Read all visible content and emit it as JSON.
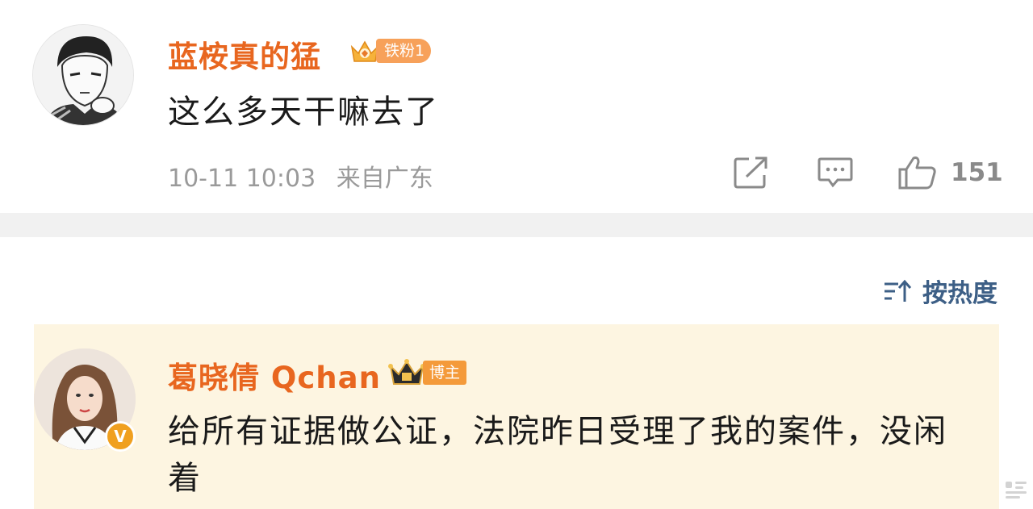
{
  "top_comment": {
    "username": "蓝桉真的猛",
    "fan_badge": "铁粉1",
    "text": "这么多天干嘛去了",
    "date": "10-11 10:03",
    "location": "来自广东",
    "like_count": "151",
    "icons": [
      "share-icon",
      "comment-icon",
      "like-icon"
    ]
  },
  "sort": {
    "label": "按热度",
    "icon": "sort-icon"
  },
  "highlight_comment": {
    "username": "葛晓倩 Qchan",
    "owner_badge": "博主",
    "text": "给所有证据做公证，法院昨日受理了我的案件，没闲着",
    "verified_badge": "V"
  },
  "colors": {
    "username": "#e8661f",
    "meta": "#9a9a9a",
    "sort": "#3d5f86",
    "highlight_bg": "#fdf5e1",
    "divider": "#f1f1f1"
  }
}
